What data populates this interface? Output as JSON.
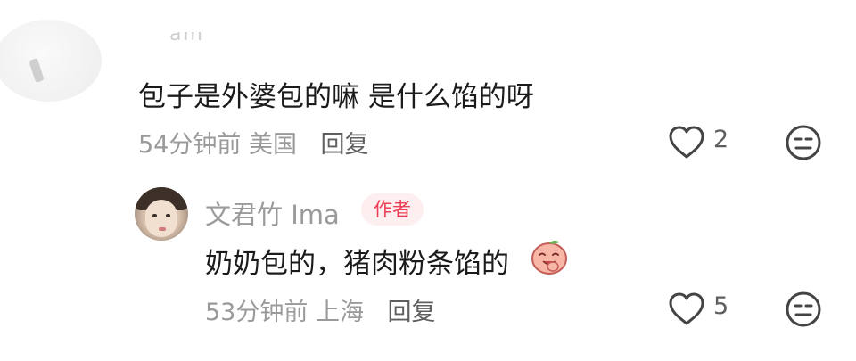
{
  "comment": {
    "partial_username": "am",
    "text": "包子是外婆包的嘛 是什么馅的呀",
    "time": "54分钟前",
    "location": "美国",
    "reply_label": "回复",
    "like_count": "2"
  },
  "reply": {
    "username": "文君竹 Ima",
    "badge": "作者",
    "text": "奶奶包的，猪肉粉条馅的",
    "emoji": "laughing-peach-emoji",
    "time": "53分钟前",
    "location": "上海",
    "reply_label": "回复",
    "like_count": "5"
  },
  "colors": {
    "text": "#1b1b1b",
    "meta": "#9a9a9a",
    "badge_text": "#ec3e55",
    "badge_bg": "#fdeef0"
  }
}
